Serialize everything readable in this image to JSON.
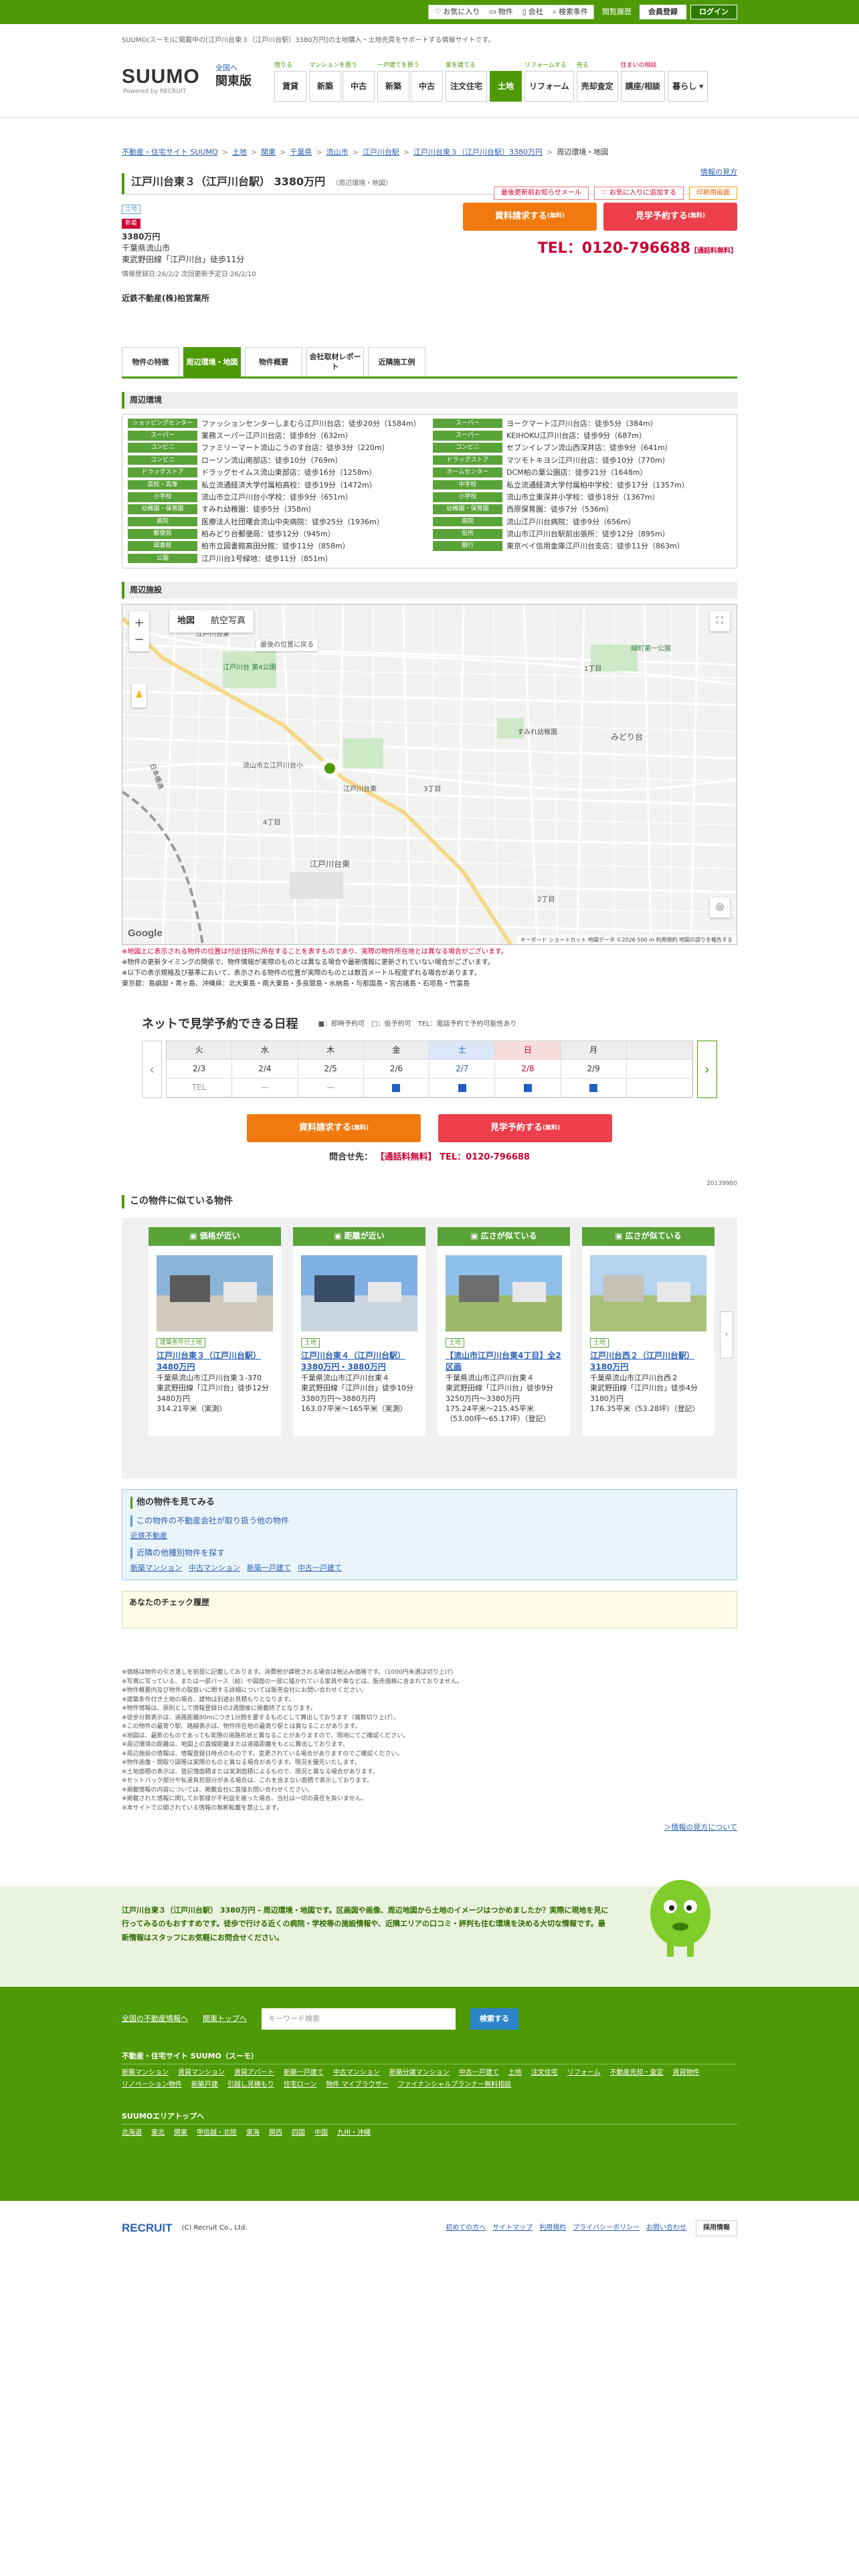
{
  "topbar": {
    "tagline": "SUUMO(スーモ)に掲載中の[江戸川台東３（江戸川台駅）3380万円]の土地購入・土地売買をサポートする情報サイトです。",
    "links": [
      "お気に入り",
      "物件",
      "会社",
      "検索条件"
    ],
    "history": "閲覧履歴",
    "member": "会員登録",
    "login": "ログイン"
  },
  "header": {
    "logo": "SUUMO",
    "logo_sub": "Powered by RECRUIT",
    "region": "関東版",
    "region_change": "全国へ",
    "nav_groups": [
      {
        "caption": "借りる",
        "items": [
          "賃貸"
        ]
      },
      {
        "caption": "マンションを買う",
        "items": [
          "新築",
          "中古"
        ]
      },
      {
        "caption": "一戸建てを買う",
        "items": [
          "新築",
          "中古"
        ]
      },
      {
        "caption": "家を建てる",
        "items": [
          "注文住宅"
        ]
      },
      {
        "caption": "",
        "items": [
          "土地"
        ]
      },
      {
        "caption": "リフォームする",
        "items": [
          "リフォーム"
        ]
      },
      {
        "caption": "売る",
        "items": [
          "売却査定"
        ]
      },
      {
        "caption": "住まいの相談",
        "items": [
          "講座/相談"
        ]
      },
      {
        "caption": "",
        "items": [
          "暮らし ▾"
        ]
      }
    ]
  },
  "breadcrumb": [
    "不動産・住宅サイト SUUMO",
    "土地",
    "関東",
    "千葉県",
    "流山市",
    "江戸川台駅",
    "江戸川台東３（江戸川台駅）3380万円",
    "周辺環境・地図"
  ],
  "info_help": "情報の見方",
  "property": {
    "title": "江戸川台東３（江戸川台駅） 3380万円",
    "subtitle": "（周辺環境・地図）",
    "header_buttons": [
      "最後更新前お知らせメール",
      "お気に入りに追加する",
      "印刷用画面"
    ],
    "tag": "土地",
    "new_tag": "新着",
    "price": "3380万円",
    "address": "千葉県流山市",
    "station": "東武野田線「江戸川台」徒歩11分",
    "updated": "情報登録日:26/2/2  次回更新予定日:26/2/10",
    "company": "近鉄不動産(株)柏営業所",
    "request_btn": "資料請求する",
    "request_note": "(無料)",
    "visit_btn": "見学予約する",
    "visit_note": "(無料)",
    "tel": "TEL：0120-796688",
    "tel_note": "【通話料無料】"
  },
  "tabs": [
    "物件の特徴",
    "周辺環境・地図",
    "物件概要",
    "会社取材レポート",
    "近隣施工例"
  ],
  "env_title": "周辺環境",
  "env": [
    {
      "cat": "ショッピングセンター",
      "text": "ファッションセンターしまむら江戸川台店：徒歩20分（1584m）"
    },
    {
      "cat": "スーパー",
      "text": "ヨークマート江戸川台店：徒歩5分（384m）"
    },
    {
      "cat": "スーパー",
      "text": "業務スーパー江戸川台店：徒歩8分（632m）"
    },
    {
      "cat": "スーパー",
      "text": "KEIHOKU江戸川台店：徒歩9分（687m）"
    },
    {
      "cat": "コンビニ",
      "text": "ファミリーマート流山こうのす台店：徒歩3分（220m）"
    },
    {
      "cat": "コンビニ",
      "text": "セブンイレブン流山西深井店：徒歩9分（641m）"
    },
    {
      "cat": "コンビニ",
      "text": "ローソン流山南部店：徒歩10分（769m）"
    },
    {
      "cat": "ドラッグストア",
      "text": "マツモトキヨシ江戸川台店：徒歩10分（770m）"
    },
    {
      "cat": "ドラッグストア",
      "text": "ドラッグセイムス流山東部店：徒歩16分（1258m）"
    },
    {
      "cat": "ホームセンター",
      "text": "DCM柏の葉公園店：徒歩21分（1648m）"
    },
    {
      "cat": "高校・高専",
      "text": "私立流通経済大学付属柏高校：徒歩19分（1472m）"
    },
    {
      "cat": "中学校",
      "text": "私立流通経済大学付属柏中学校：徒歩17分（1357m）"
    },
    {
      "cat": "小学校",
      "text": "流山市立江戸川台小学校：徒歩9分（651m）"
    },
    {
      "cat": "小学校",
      "text": "流山市立東深井小学校：徒歩18分（1367m）"
    },
    {
      "cat": "幼稚園・保育園",
      "text": "すみれ幼稚園：徒歩5分（358m）"
    },
    {
      "cat": "幼稚園・保育園",
      "text": "西原保育園：徒歩7分（536m）"
    },
    {
      "cat": "病院",
      "text": "医療法人社団曙会流山中央病院：徒歩25分（1936m）"
    },
    {
      "cat": "病院",
      "text": "流山江戸川台病院：徒歩9分（656m）"
    },
    {
      "cat": "郵便局",
      "text": "柏みどり台郵便局：徒歩12分（945m）"
    },
    {
      "cat": "役所",
      "text": "流山市江戸川台駅前出張所：徒歩12分（895m）"
    },
    {
      "cat": "図書館",
      "text": "柏市立図書館高田分館：徒歩11分（858m）"
    },
    {
      "cat": "銀行",
      "text": "東京ベイ信用金庫江戸川台支店：徒歩11分（863m）"
    },
    {
      "cat": "公園",
      "text": "江戸川台1号緑地：徒歩11分（851m）"
    }
  ],
  "map": {
    "title": "周辺施設",
    "type_map": "地図",
    "type_sat": "航空写真",
    "google": "Google",
    "footer": "キーボード ショートカット  地図データ ©2026  500 m  利用規約  地図の誤りを報告する",
    "labels": [
      "江戸川台東",
      "江戸川台 第4公園",
      "最後の位置に戻る",
      "流山市立江戸川台小",
      "江戸川台東",
      "すみれ幼稚園",
      "緑町第一公園",
      "みどり台",
      "1丁目",
      "2丁目",
      "3丁目",
      "4丁目",
      "日本橋通",
      "江戸川台東"
    ],
    "note_red": "※地図上に表示される物件の位置は付近住所に所在することを表すものであり、実際の物件所在地とは異なる場合がございます。",
    "note1": "※物件の更新タイミングの関係で、物件情報が実際のものとは異なる場合や最新情報に更新されていない場合がございます。",
    "note2": "※以下の表示規格及び基準において、表示される物件の位置が実際のものとは数百メートル程度ずれる場合があります。",
    "note3": "東京都：島嶼部・青ヶ島、沖縄県：北大東島・南大東島・多良間島・水納島・与那国島・宮古諸島・石垣島・竹富島"
  },
  "calendar": {
    "title": "ネットで見学予約できる日程",
    "legend": [
      "■：即時予約可",
      "□：仮予約可",
      "TEL：電話予約で予約可能性あり"
    ],
    "days": [
      {
        "dw": "火",
        "dt": "2/3",
        "st": "TEL",
        "kind": ""
      },
      {
        "dw": "水",
        "dt": "2/4",
        "st": "—",
        "kind": ""
      },
      {
        "dw": "木",
        "dt": "2/5",
        "st": "—",
        "kind": ""
      },
      {
        "dw": "金",
        "dt": "2/6",
        "st": "■",
        "kind": ""
      },
      {
        "dw": "土",
        "dt": "2/7",
        "st": "■",
        "kind": "sat"
      },
      {
        "dw": "日",
        "dt": "2/8",
        "st": "■",
        "kind": "sun"
      },
      {
        "dw": "月",
        "dt": "2/9",
        "st": "■",
        "kind": ""
      }
    ],
    "tel_label": "問合せ先：",
    "tel_free": "【通話料無料】",
    "tel": "TEL：0120-796688",
    "prop_id": "20139980"
  },
  "similar": {
    "title": "この物件に似ている物件",
    "cards": [
      {
        "head": "価格が近い",
        "tag": "建築条件付土地",
        "title": "江戸川台東３（江戸川台駅） 3480万円",
        "addr": "千葉県流山市江戸川台東３-370",
        "station": "東武野田線「江戸川台」徒歩12分",
        "price": "3480万円",
        "area": "314.21平米（実測）"
      },
      {
        "head": "距離が近い",
        "tag": "土地",
        "title": "江戸川台東４（江戸川台駅） 3380万円・3880万円",
        "addr": "千葉県流山市江戸川台東４",
        "station": "東武野田線「江戸川台」徒歩10分",
        "price": "3380万円～3880万円",
        "area": "163.07平米～165平米（実測）"
      },
      {
        "head": "広さが似ている",
        "tag": "土地",
        "title": "【流山市江戸川台東4丁目】全2区画",
        "addr": "千葉県流山市江戸川台東４",
        "station": "東武野田線「江戸川台」徒歩9分",
        "price": "3250万円～3380万円",
        "area": "175.24平米～215.45平米（53.00坪～65.17坪）（登記）"
      },
      {
        "head": "広さが似ている",
        "tag": "土地",
        "title": "江戸川台西２（江戸川台駅） 3180万円",
        "addr": "千葉県流山市江戸川台西２",
        "station": "東武野田線「江戸川台」徒歩4分",
        "price": "3180万円",
        "area": "176.35平米（53.28坪）（登記）"
      }
    ]
  },
  "other": {
    "title": "他の物件を見てみる",
    "h1": "この物件の不動産会社が取り扱う他の物件",
    "l1": "近鉄不動産",
    "h2": "近隣の他種別物件を探す",
    "links": [
      "新築マンション",
      "中古マンション",
      "新築一戸建て",
      "中古一戸建て"
    ]
  },
  "check_title": "あなたのチェック履歴",
  "notes": [
    "※価格は物件の引き渡しを前提に記載しております。消費税が課税される場合は税込み価格です。（1000円未満は切り上げ）",
    "※写真に写っている、または一部パース（絵）や図面の一部に描かれている家具や車などは、販売価格に含まれておりません。",
    "※物件概要内及び物件の取扱いに関する詳細については販売会社にお問い合わせください。",
    "※建築条件付き土地の場合、建物は別途お見積もりとなります。",
    "※物件情報は、原則として情報登録日の2週間後に掲載終了となります。",
    "※徒歩分数表示は、道路距離80mにつき1分間を要するものとして算出しております（端数切り上げ）。",
    "※この物件の最寄り駅、路線表示は、物件所在地の最寄り駅とは異なることがあります。",
    "※地図は、最新のものであっても実際の道路形状と異なることがありますので、現地にてご確認ください。",
    "※周辺環境の距離は、地図上の直線距離または道路距離をもとに算出しております。",
    "※周辺施設の情報は、情報登録日時点のものです。変更されている場合がありますのでご確認ください。",
    "※物件画像・間取り図等は実際のものと異なる場合があります。現況を優先いたします。",
    "※土地面積の表示は、登記簿面積または実測面積によるもので、現況と異なる場合があります。",
    "※セットバック部分や私道負担部分がある場合は、これを含まない面積で表示しております。",
    "※掲載情報の内容については、掲載会社に直接お問い合わせください。",
    "※掲載された情報に関してお客様が不利益を被った場合、当社は一切の責任を負いません。",
    "※本サイトで公開されている情報の無断転載を禁止します。"
  ],
  "notes_link": "＞情報の見方について",
  "band": {
    "text": "江戸川台東３（江戸川台駅） 3380万円 - 周辺環境・地図です。区画図や画像、周辺地図から土地のイメージはつかめましたか？実際に現地を見に行ってみるのもおすすめです。徒歩で行ける近くの病院・学校等の施設情報や、近隣エリアの口コミ・評判も住む環境を決める大切な情報です。最新情報はスタッフにお気軽にお問合せください。"
  },
  "footer": {
    "links_top": [
      "全国の不動産情報へ",
      "関東トップへ"
    ],
    "keyword_placeholder": "キーワード検索",
    "search_btn": "検索する",
    "h1": "不動産・住宅サイト SUUMO（スーモ）",
    "l1": [
      "新築マンション",
      "賃貸マンション",
      "賃貸アパート",
      "新築一戸建て",
      "中古マンション",
      "新築分譲マンション",
      "中古一戸建て",
      "土地",
      "注文住宅",
      "リフォーム",
      "不動産売却・査定",
      "賃貸物件",
      "リノベーション物件",
      "新築戸建",
      "引越し見積もり",
      "住宅ローン",
      "物件 マイブラウザー",
      "ファイナンシャルプランナー無料相談"
    ],
    "h2": "SUUMOエリアトップへ",
    "l2": [
      "北海道",
      "東北",
      "関東",
      "甲信越・北陸",
      "東海",
      "関西",
      "四国",
      "中国",
      "九州・沖縄"
    ],
    "company": "RECRUIT",
    "copyright": "(C) Recruit Co., Ltd.",
    "bottom_links": [
      "初めての方へ",
      "サイトマップ",
      "利用規約",
      "プライバシーポリシー",
      "お問い合わせ"
    ],
    "privacy": "採用情報"
  }
}
